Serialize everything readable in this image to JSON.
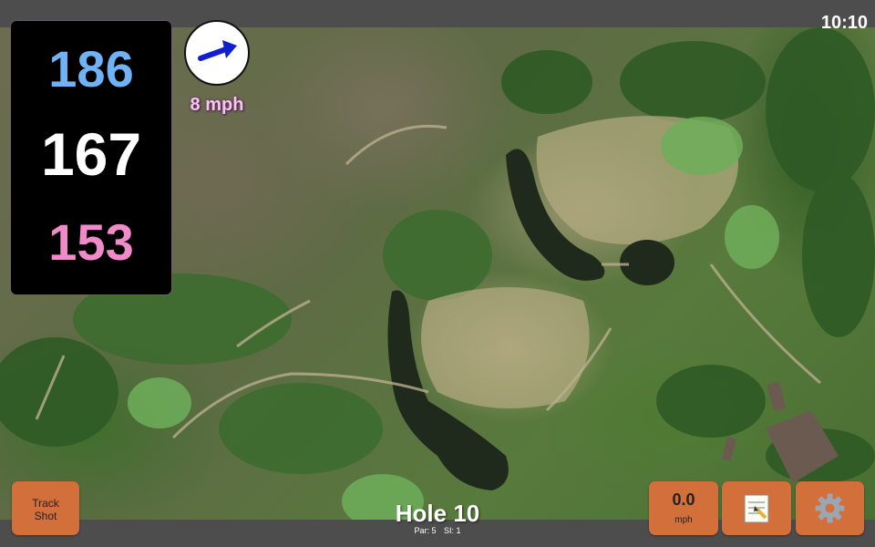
{
  "status_bar": {
    "time": "10:10"
  },
  "distances": {
    "back": "186",
    "middle": "167",
    "front": "153"
  },
  "wind": {
    "speed": "8 mph",
    "icon": "wind-arrow-icon"
  },
  "hole": {
    "title": "Hole 10",
    "par_label": "Par: 5",
    "si_label": "SI: 1"
  },
  "buttons": {
    "track_shot_line1": "Track",
    "track_shot_line2": "Shot",
    "speed_value": "0.0",
    "speed_unit": "mph",
    "notes_icon": "notepad-icon",
    "settings_icon": "gear-icon"
  },
  "colors": {
    "back": "#6fb3f4",
    "middle": "#ffffff",
    "front": "#f08ac8",
    "button": "#d36f3b",
    "wind_text": "#f7c6ef"
  }
}
